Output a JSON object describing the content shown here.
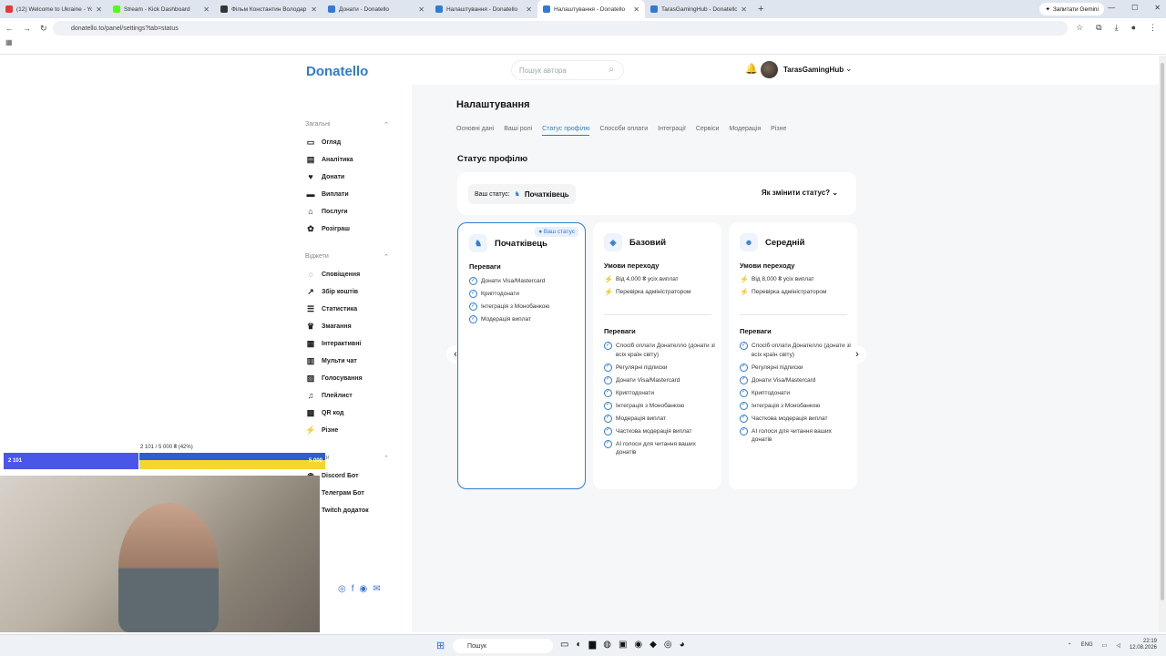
{
  "browser": {
    "tabs": [
      {
        "title": "(12) Welcome to Ukraine - YouTube",
        "color": "#e53935"
      },
      {
        "title": "Stream - Kick Dashboard",
        "color": "#53fc18"
      },
      {
        "title": "Фільм Константин Володар пекла",
        "color": "#333333"
      },
      {
        "title": "Донати - Donatello",
        "color": "#2f7bd8"
      },
      {
        "title": "Налаштування - Donatello",
        "color": "#2f7bd8"
      },
      {
        "title": "Налаштування - Donatello",
        "color": "#2f7bd8"
      },
      {
        "title": "TarasGamingHub - Donatello",
        "color": "#2f7bd8"
      }
    ],
    "active_tab": 5,
    "gemini_label": "Запитати Gemini",
    "url": "donatello.to/panel/settings?tab=status"
  },
  "header": {
    "logo": "Donatello",
    "search_placeholder": "Пошук автора",
    "username": "TarasGamingHub"
  },
  "sidebar": {
    "groups": [
      {
        "title": "Загальні",
        "items": [
          {
            "label": "Огляд",
            "icon": "monitor-icon"
          },
          {
            "label": "Аналітика",
            "icon": "chart-icon"
          },
          {
            "label": "Донати",
            "icon": "heart-icon"
          },
          {
            "label": "Виплати",
            "icon": "card-icon"
          },
          {
            "label": "Послуги",
            "icon": "bank-icon"
          },
          {
            "label": "Розіграш",
            "icon": "gift-icon"
          }
        ]
      },
      {
        "title": "Віджети",
        "items": [
          {
            "label": "Сповіщення",
            "icon": "chat-icon"
          },
          {
            "label": "Збір коштів",
            "icon": "trend-icon"
          },
          {
            "label": "Статистика",
            "icon": "list-icon"
          },
          {
            "label": "Змагання",
            "icon": "crown-icon"
          },
          {
            "label": "Інтерактивні",
            "icon": "grid-icon"
          },
          {
            "label": "Мульти чат",
            "icon": "multichat-icon"
          },
          {
            "label": "Голосування",
            "icon": "vote-icon"
          },
          {
            "label": "Плейлист",
            "icon": "music-icon"
          },
          {
            "label": "QR код",
            "icon": "qr-icon"
          },
          {
            "label": "Різне",
            "icon": "bolt-icon"
          }
        ]
      },
      {
        "title": "Додатки",
        "items": [
          {
            "label": "Discord Бот",
            "icon": "discord-icon"
          },
          {
            "label": "Телеграм Бот",
            "icon": "telegram-icon"
          },
          {
            "label": "Twitch додаток",
            "icon": "twitch-icon"
          }
        ]
      }
    ]
  },
  "main": {
    "title": "Налаштування",
    "tabs": [
      "Основні дані",
      "Ваші ролі",
      "Статус профілю",
      "Способи оплати",
      "Інтеграції",
      "Сервіси",
      "Модерація",
      "Різне"
    ],
    "active_tab": 2,
    "section_title": "Статус профілю",
    "status_label": "Ваш статус:",
    "status_value": "Початківець",
    "how_to_change": "Як змінити статус?",
    "cards": [
      {
        "title": "Початківець",
        "badge": "Ваш статус",
        "benefits_label": "Переваги",
        "benefits": [
          "Донати Visa/Mastercard",
          "Криптодонати",
          "Інтеграція з Монобанкою",
          "Модерація виплат"
        ]
      },
      {
        "title": "Базовий",
        "conditions_label": "Умови переходу",
        "conditions": [
          "Від 4,000 ₴ усіх виплат",
          "Перевірка адміністратором"
        ],
        "benefits_label": "Переваги",
        "benefits": [
          "Спосіб оплати Донателло (донати зі всіх країн світу)",
          "Регулярні підписки",
          "Донати Visa/Mastercard",
          "Криптодонати",
          "Інтеграція з Монобанкою",
          "Модерація виплат",
          "Часткова модерація виплат",
          "AI голоси для читання ваших донатів"
        ]
      },
      {
        "title": "Середній",
        "conditions_label": "Умови переходу",
        "conditions": [
          "Від 8,000 ₴ усіх виплат",
          "Перевірка адміністратором"
        ],
        "benefits_label": "Переваги",
        "benefits": [
          "Спосіб оплати Донателло (донати зі всіх країн світу)",
          "Регулярні підписки",
          "Донати Visa/Mastercard",
          "Криптодонати",
          "Інтеграція з Монобанкою",
          "Часткова модерація виплат",
          "AI голоси для читання ваших донатів"
        ]
      }
    ]
  },
  "goal": {
    "summary": "2 101 / 5 000 ₴ (42%)",
    "current": "2 101",
    "target": "5 000",
    "progress": 0.42
  },
  "taskbar": {
    "search": "Пошук",
    "lang": "ENG",
    "time": "22:19",
    "date": "12.08.2026"
  },
  "colors": {
    "accent": "#2f7bd8",
    "goal_fill": "#4a56e8"
  }
}
